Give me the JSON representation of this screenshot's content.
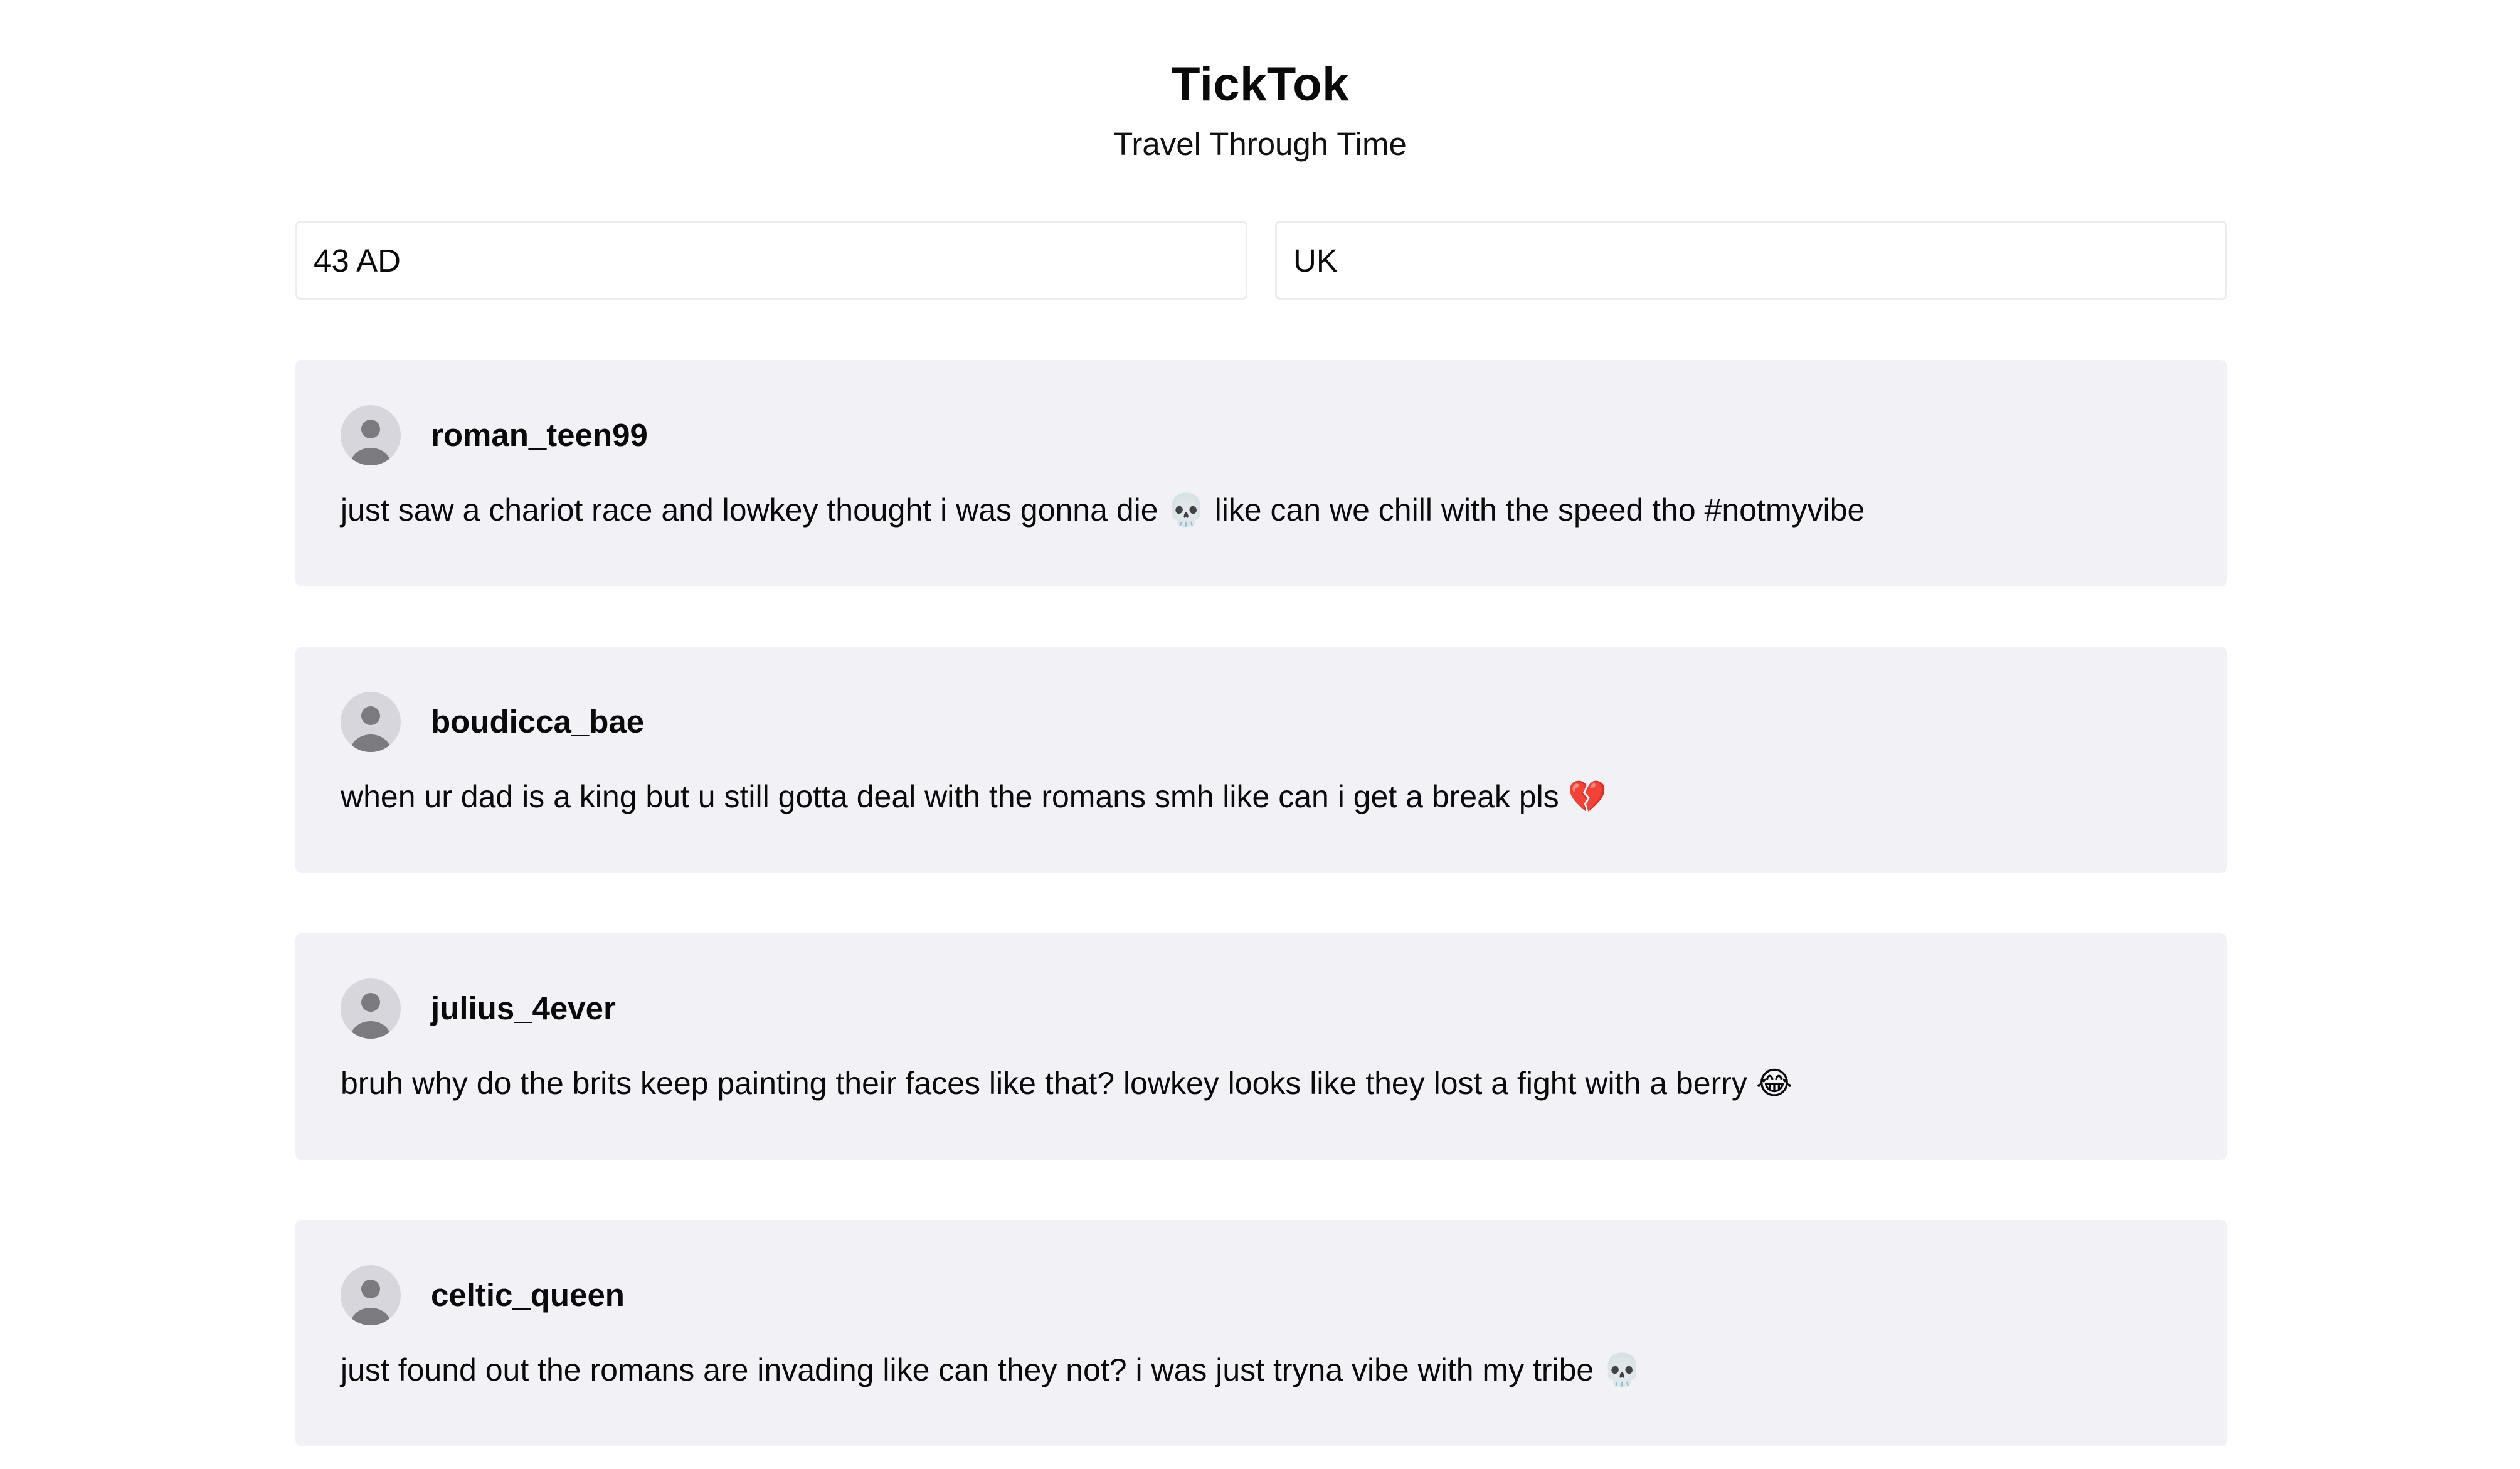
{
  "app": {
    "title": "TickTok",
    "subtitle": "Travel Through Time"
  },
  "filters": {
    "year_value": "43 AD",
    "location_value": "UK"
  },
  "posts": [
    {
      "username": "roman_teen99",
      "text": "just saw a chariot race and lowkey thought i was gonna die 💀 like can we chill with the speed tho #notmyvibe"
    },
    {
      "username": "boudicca_bae",
      "text": "when ur dad is a king but u still gotta deal with the romans smh like can i get a break pls 💔"
    },
    {
      "username": "julius_4ever",
      "text": "bruh why do the brits keep painting their faces like that? lowkey looks like they lost a fight with a berry 😂"
    },
    {
      "username": "celtic_queen",
      "text": "just found out the romans are invading like can they not? i was just tryna vibe with my tribe 💀"
    }
  ],
  "icons": {
    "avatar": "user-avatar-icon"
  },
  "colors": {
    "card_background": "#f2f2f6",
    "avatar_background": "#d6d6dc",
    "avatar_figure": "#7a7a7f",
    "input_border": "#ececf0"
  }
}
